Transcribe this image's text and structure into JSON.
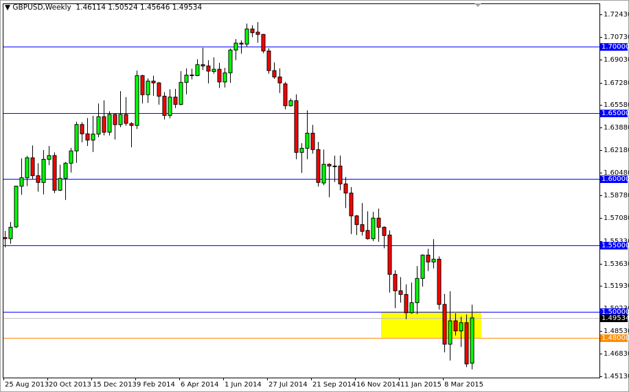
{
  "header": {
    "symbol": "GBPUSD,Weekly",
    "open": "1.46114",
    "high": "1.50524",
    "low": "1.45646",
    "close": "1.49534"
  },
  "colors": {
    "bull": "#00ff00",
    "bear": "#ff0000",
    "level_line": "#0000ff",
    "bid_line": "#c0c0c0",
    "support_line": "#ff8c00",
    "zone": "#ffff00"
  },
  "chart_data": {
    "type": "candlestick",
    "title": "GBPUSD,Weekly",
    "ylim": [
      1.4513,
      1.7243
    ],
    "y_ticks": [
      "1.72430",
      "1.70730",
      "1.69030",
      "1.67280",
      "1.65580",
      "1.63880",
      "1.62180",
      "1.60480",
      "1.58780",
      "1.57080",
      "1.55330",
      "1.53630",
      "1.51930",
      "1.50230",
      "1.48530",
      "1.46830",
      "1.45130"
    ],
    "x_tick_labels": [
      "25 Aug 2013",
      "20 Oct 2013",
      "15 Dec 2013",
      "9 Feb 2014",
      "6 Apr 2014",
      "1 Jun 2014",
      "27 Jul 2014",
      "21 Sep 2014",
      "16 Nov 2014",
      "11 Jan 2015",
      "8 Mar 2015"
    ],
    "x_tick_every_weeks": 8,
    "ohlc": [
      [
        1.5559,
        1.5609,
        1.5485,
        1.5551
      ],
      [
        1.5551,
        1.5677,
        1.5513,
        1.5637
      ],
      [
        1.564,
        1.595,
        1.5631,
        1.5947
      ],
      [
        1.5947,
        1.6157,
        1.5882,
        1.6011
      ],
      [
        1.6011,
        1.6175,
        1.5947,
        1.6161
      ],
      [
        1.6161,
        1.6254,
        1.5999,
        1.6026
      ],
      [
        1.6026,
        1.612,
        1.5906,
        1.5975
      ],
      [
        1.5975,
        1.6219,
        1.5885,
        1.615
      ],
      [
        1.615,
        1.625,
        1.6106,
        1.6178
      ],
      [
        1.6178,
        1.6202,
        1.5895,
        1.5916
      ],
      [
        1.5916,
        1.6109,
        1.591,
        1.6006
      ],
      [
        1.6006,
        1.613,
        1.5843,
        1.612
      ],
      [
        1.612,
        1.6236,
        1.605,
        1.6213
      ],
      [
        1.6213,
        1.6433,
        1.6123,
        1.6412
      ],
      [
        1.6412,
        1.643,
        1.6278,
        1.6342
      ],
      [
        1.6342,
        1.6461,
        1.625,
        1.6295
      ],
      [
        1.6295,
        1.6478,
        1.6205,
        1.634
      ],
      [
        1.634,
        1.6571,
        1.6316,
        1.6471
      ],
      [
        1.6471,
        1.6595,
        1.633,
        1.6354
      ],
      [
        1.6354,
        1.6512,
        1.633,
        1.6488
      ],
      [
        1.6488,
        1.6495,
        1.6299,
        1.6411
      ],
      [
        1.6411,
        1.6664,
        1.6392,
        1.6488
      ],
      [
        1.6488,
        1.6619,
        1.6402,
        1.6421
      ],
      [
        1.6419,
        1.643,
        1.624,
        1.6405
      ],
      [
        1.6405,
        1.6819,
        1.6378,
        1.6781
      ],
      [
        1.6781,
        1.6788,
        1.6571,
        1.6637
      ],
      [
        1.6637,
        1.6761,
        1.6575,
        1.674
      ],
      [
        1.674,
        1.6781,
        1.6629,
        1.6726
      ],
      [
        1.6726,
        1.6733,
        1.6562,
        1.6626
      ],
      [
        1.6626,
        1.6657,
        1.645,
        1.6481
      ],
      [
        1.6481,
        1.6678,
        1.6459,
        1.6619
      ],
      [
        1.6619,
        1.6681,
        1.6536,
        1.6564
      ],
      [
        1.6564,
        1.6815,
        1.6557,
        1.673
      ],
      [
        1.673,
        1.6836,
        1.664,
        1.6785
      ],
      [
        1.6781,
        1.6833,
        1.6753,
        1.6786
      ],
      [
        1.6781,
        1.6905,
        1.6777,
        1.6864
      ],
      [
        1.6864,
        1.6991,
        1.6823,
        1.6854
      ],
      [
        1.6854,
        1.6898,
        1.6722,
        1.6815
      ],
      [
        1.6812,
        1.6919,
        1.6795,
        1.6829
      ],
      [
        1.6829,
        1.6878,
        1.6688,
        1.6733
      ],
      [
        1.6733,
        1.684,
        1.6691,
        1.6802
      ],
      [
        1.6802,
        1.6985,
        1.6726,
        1.6974
      ],
      [
        1.6974,
        1.7057,
        1.6898,
        1.7026
      ],
      [
        1.7026,
        1.7047,
        1.6947,
        1.7019
      ],
      [
        1.7019,
        1.7174,
        1.6998,
        1.7133
      ],
      [
        1.7133,
        1.716,
        1.7071,
        1.7105
      ],
      [
        1.7109,
        1.7185,
        1.7029,
        1.7092
      ],
      [
        1.7092,
        1.7095,
        1.695,
        1.6967
      ],
      [
        1.6967,
        1.6988,
        1.6795,
        1.6819
      ],
      [
        1.6819,
        1.6881,
        1.6757,
        1.6771
      ],
      [
        1.6771,
        1.6836,
        1.665,
        1.6726
      ],
      [
        1.6719,
        1.6733,
        1.6526,
        1.6554
      ],
      [
        1.6554,
        1.6609,
        1.6547,
        1.6592
      ],
      [
        1.6592,
        1.664,
        1.615,
        1.6202
      ],
      [
        1.6202,
        1.6271,
        1.6047,
        1.6233
      ],
      [
        1.6233,
        1.6519,
        1.615,
        1.6347
      ],
      [
        1.6347,
        1.6409,
        1.6192,
        1.6223
      ],
      [
        1.6223,
        1.6281,
        1.5944,
        1.5975
      ],
      [
        1.5971,
        1.6223,
        1.5954,
        1.6112
      ],
      [
        1.6112,
        1.6119,
        1.5864,
        1.6099
      ],
      [
        1.6099,
        1.6178,
        1.5978,
        1.6099
      ],
      [
        1.6099,
        1.6178,
        1.5916,
        1.5964
      ],
      [
        1.5964,
        1.6016,
        1.5782,
        1.5895
      ],
      [
        1.5895,
        1.594,
        1.5585,
        1.5723
      ],
      [
        1.5723,
        1.573,
        1.5578,
        1.5657
      ],
      [
        1.5657,
        1.582,
        1.5575,
        1.5606
      ],
      [
        1.5613,
        1.5758,
        1.5544,
        1.5551
      ],
      [
        1.5551,
        1.5754,
        1.5533,
        1.5706
      ],
      [
        1.5706,
        1.5778,
        1.5527,
        1.5637
      ],
      [
        1.5637,
        1.5644,
        1.5478,
        1.5575
      ],
      [
        1.5578,
        1.5613,
        1.5144,
        1.5282
      ],
      [
        1.5282,
        1.5313,
        1.5027,
        1.5158
      ],
      [
        1.5158,
        1.5261,
        1.5068,
        1.513
      ],
      [
        1.513,
        1.5206,
        1.4944,
        1.4992
      ],
      [
        1.4992,
        1.522,
        1.4985,
        1.5068
      ],
      [
        1.5068,
        1.5344,
        1.4982,
        1.5251
      ],
      [
        1.5251,
        1.5433,
        1.5189,
        1.5427
      ],
      [
        1.5427,
        1.5475,
        1.5306,
        1.5375
      ],
      [
        1.5375,
        1.5547,
        1.5326,
        1.5396
      ],
      [
        1.5396,
        1.5417,
        1.5016,
        1.5055
      ],
      [
        1.5055,
        1.5134,
        1.4693,
        1.4755
      ],
      [
        1.4755,
        1.5154,
        1.4631,
        1.4931
      ],
      [
        1.4931,
        1.4989,
        1.482,
        1.4855
      ],
      [
        1.4855,
        1.4962,
        1.4734,
        1.4917
      ],
      [
        1.4917,
        1.4979,
        1.4582,
        1.4606
      ],
      [
        1.46114,
        1.50524,
        1.45646,
        1.49534
      ]
    ],
    "horizontal_levels": [
      {
        "price": 1.7,
        "label": "1.70000",
        "color": "#0000ff"
      },
      {
        "price": 1.65,
        "label": "1.65000",
        "color": "#0000ff"
      },
      {
        "price": 1.6,
        "label": "1.60000",
        "color": "#0000ff"
      },
      {
        "price": 1.55,
        "label": "1.55000",
        "color": "#0000ff"
      },
      {
        "price": 1.5,
        "label": "1.50000",
        "color": "#0000ff"
      },
      {
        "price": 1.49534,
        "label": "1.49534",
        "color": "#c0c0c0",
        "badge": "#000000"
      },
      {
        "price": 1.48,
        "label": "1.48000",
        "color": "#ff8c00"
      }
    ],
    "zone": {
      "from_price": 1.48,
      "to_price": 1.5,
      "start_candle": 69,
      "color": "#ffff00"
    }
  }
}
